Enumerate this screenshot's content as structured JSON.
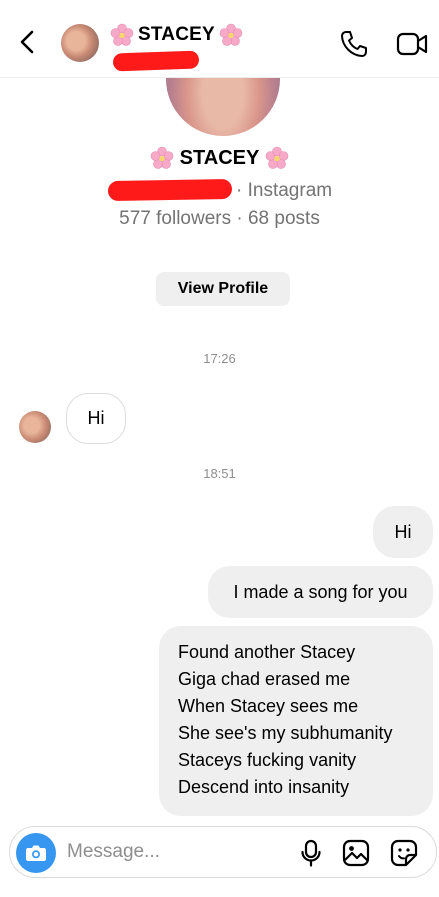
{
  "header": {
    "title_prefix_icon": "cherry-blossom-emoji",
    "title": "STACEY",
    "title_suffix_icon": "cherry-blossom-emoji",
    "back_icon": "chevron-left-icon",
    "call_icon": "phone-icon",
    "video_icon": "video-camera-icon"
  },
  "profile": {
    "name": "STACEY",
    "platform": "· Instagram",
    "stats": "577 followers · 68 posts",
    "view_profile_label": "View Profile"
  },
  "messages": {
    "time1": "17:26",
    "incoming1": "Hi",
    "time2": "18:51",
    "outgoing1": "Hi",
    "outgoing2": "I made a song for you",
    "song": [
      "Found another Stacey",
      "Giga chad erased me",
      "When Stacey sees me",
      "She see's my subhumanity",
      "Staceys fucking vanity",
      "Descend into insanity"
    ]
  },
  "composer": {
    "placeholder": "Message...",
    "icons": [
      "camera-icon",
      "microphone-icon",
      "gallery-icon",
      "sticker-icon"
    ]
  },
  "colors": {
    "accent": "#3797f0",
    "redaction": "#ff1a1a",
    "bubble_out": "#efefef",
    "muted_text": "#737373"
  }
}
